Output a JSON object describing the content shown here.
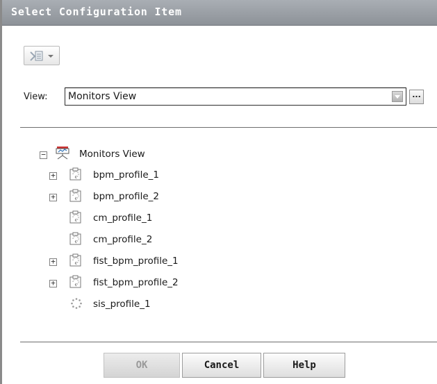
{
  "dialog": {
    "title": "Select Configuration Item"
  },
  "toolbar": {
    "icons": [
      "mapping-icon",
      "chevron-down-icon"
    ]
  },
  "view": {
    "label": "View:",
    "value": "Monitors View",
    "browse_label": "..."
  },
  "tree": {
    "root": {
      "label": "Monitors View",
      "expander": "⊟",
      "icon": "monitors-view-icon"
    },
    "items": [
      {
        "label": "bpm_profile_1",
        "expander": "+",
        "icon": "profile-icon"
      },
      {
        "label": "bpm_profile_2",
        "expander": "+",
        "icon": "profile-icon"
      },
      {
        "label": "cm_profile_1",
        "expander": "",
        "icon": "profile-icon"
      },
      {
        "label": "cm_profile_2",
        "expander": "",
        "icon": "profile-icon"
      },
      {
        "label": "fist_bpm_profile_1",
        "expander": "+",
        "icon": "profile-icon"
      },
      {
        "label": "fist_bpm_profile_2",
        "expander": "+",
        "icon": "profile-icon"
      },
      {
        "label": "sis_profile_1",
        "expander": "",
        "icon": "sis-profile-icon"
      }
    ]
  },
  "buttons": {
    "ok": "OK",
    "cancel": "Cancel",
    "help": "Help"
  }
}
